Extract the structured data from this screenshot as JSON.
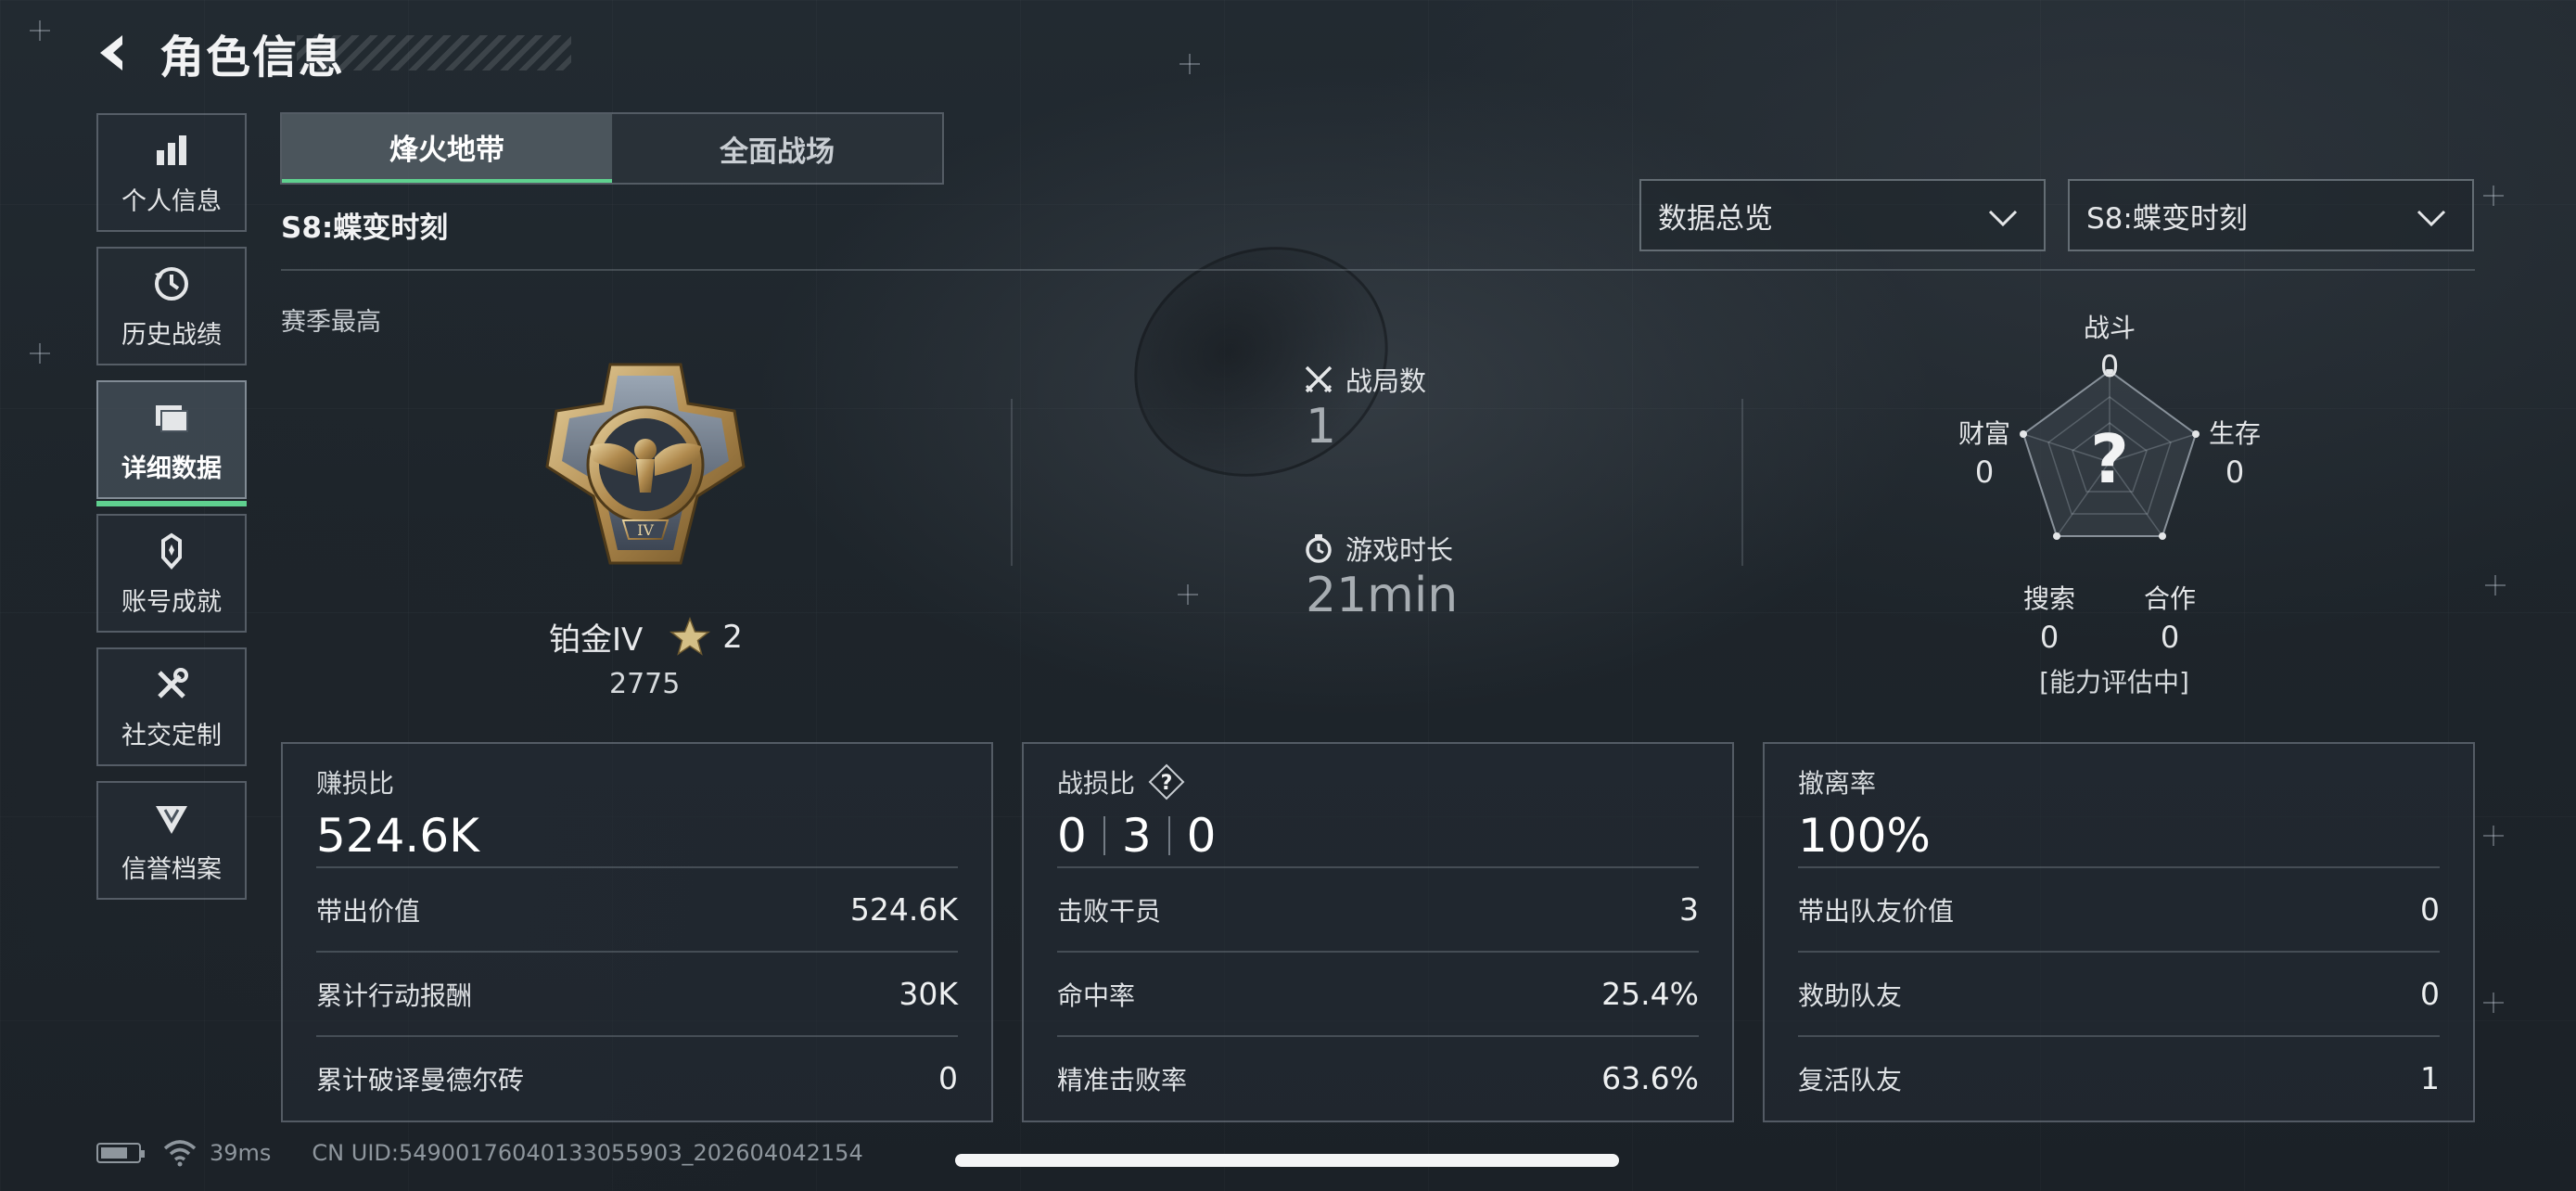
{
  "header": {
    "title": "角色信息",
    "back_icon": "chevron-left-icon"
  },
  "sidebar": {
    "items": [
      {
        "label": "个人信息",
        "icon": "bar-chart-icon",
        "active": false
      },
      {
        "label": "历史战绩",
        "icon": "history-clock-icon",
        "active": false
      },
      {
        "label": "详细数据",
        "icon": "folders-icon",
        "active": true
      },
      {
        "label": "账号成就",
        "icon": "achievement-badge-icon",
        "active": false
      },
      {
        "label": "社交定制",
        "icon": "tools-icon",
        "active": false
      },
      {
        "label": "信誉档案",
        "icon": "credit-shield-icon",
        "active": false
      }
    ]
  },
  "tabs": [
    {
      "label": "烽火地带",
      "active": true
    },
    {
      "label": "全面战场",
      "active": false
    }
  ],
  "season": {
    "label": "S8:蝶变时刻"
  },
  "filters": {
    "overview": "数据总览",
    "season": "S8:蝶变时刻"
  },
  "season_best": {
    "label": "赛季最高",
    "rank_name": "铂金IV",
    "stars": "2",
    "score": "2775"
  },
  "middle": {
    "matches_label": "战局数",
    "matches_value": "1",
    "playtime_label": "游戏时长",
    "playtime_value": "21min"
  },
  "radar": {
    "center": "?",
    "combat_label": "战斗",
    "combat_value": "0",
    "survival_label": "生存",
    "survival_value": "0",
    "teamwork_label": "合作",
    "teamwork_value": "0",
    "search_label": "搜索",
    "search_value": "0",
    "wealth_label": "财富",
    "wealth_value": "0",
    "status": "[能力评估中]"
  },
  "cards": {
    "profit": {
      "title": "赚损比",
      "value": "524.6K",
      "rows": [
        {
          "label": "带出价值",
          "value": "524.6K"
        },
        {
          "label": "累计行动报酬",
          "value": "30K"
        },
        {
          "label": "累计破译曼德尔砖",
          "value": "0"
        }
      ]
    },
    "kd": {
      "title": "战损比",
      "v1": "0",
      "v2": "3",
      "v3": "0",
      "rows": [
        {
          "label": "击败干员",
          "value": "3"
        },
        {
          "label": "命中率",
          "value": "25.4%"
        },
        {
          "label": "精准击败率",
          "value": "63.6%"
        }
      ]
    },
    "extract": {
      "title": "撤离率",
      "value": "100%",
      "rows": [
        {
          "label": "带出队友价值",
          "value": "0"
        },
        {
          "label": "救助队友",
          "value": "0"
        },
        {
          "label": "复活队友",
          "value": "1"
        }
      ]
    }
  },
  "footer": {
    "ping": "39ms",
    "uid": "CN UID:5490017604013305590З_202604042154"
  }
}
